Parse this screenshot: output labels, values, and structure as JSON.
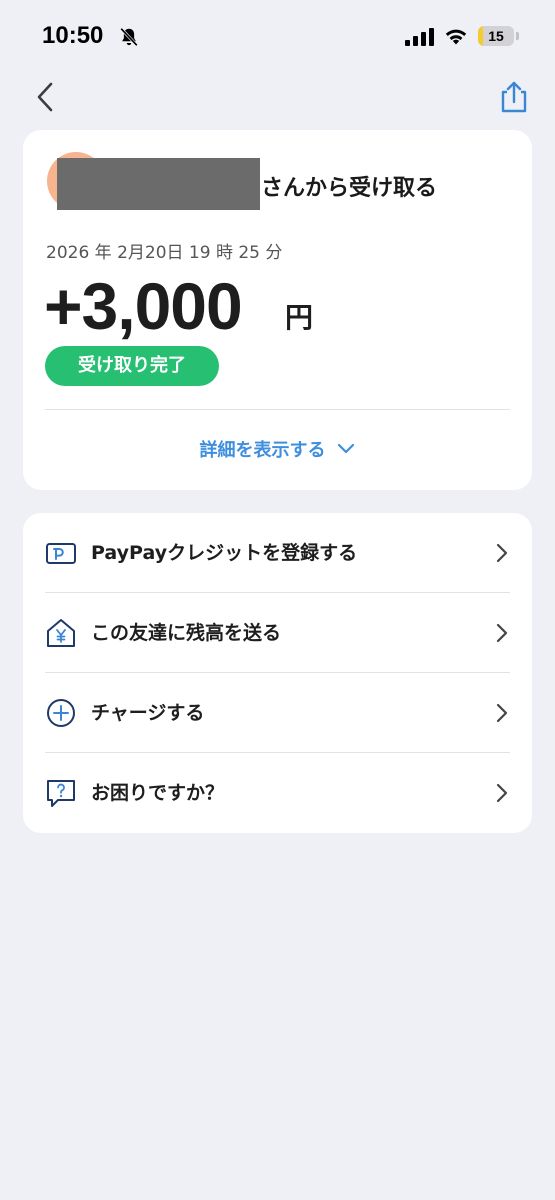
{
  "status_bar": {
    "time": "10:50",
    "battery": "15",
    "battery_level": 0.15,
    "icons": [
      "bell-slash-icon",
      "cellular-signal-icon",
      "wifi-icon",
      "battery-icon"
    ]
  },
  "nav": {
    "back_icon": "chevron-left-icon",
    "share_icon": "share-icon"
  },
  "transaction": {
    "sender_suffix": "さんから受け取る",
    "datetime": "2026 年 2月20日 19 時 25 分",
    "amount": "+3,000",
    "currency": "円",
    "status": "受け取り完了",
    "details_link": "詳細を表示する"
  },
  "actions": [
    {
      "label": "PayPayクレジットを登録する",
      "icon": "credit-card-icon"
    },
    {
      "label": "この友達に残高を送る",
      "icon": "house-yen-icon"
    },
    {
      "label": "チャージする",
      "icon": "plus-circle-icon"
    },
    {
      "label": "お困りですか？",
      "icon": "help-bubble-icon"
    }
  ],
  "colors": {
    "background": "#eff0f5",
    "status_green": "#27bf72",
    "link_blue": "#3f8fde",
    "icon_navy": "#1f3a68",
    "share_blue": "#3a86d4",
    "avatar": "#f7b58f"
  }
}
